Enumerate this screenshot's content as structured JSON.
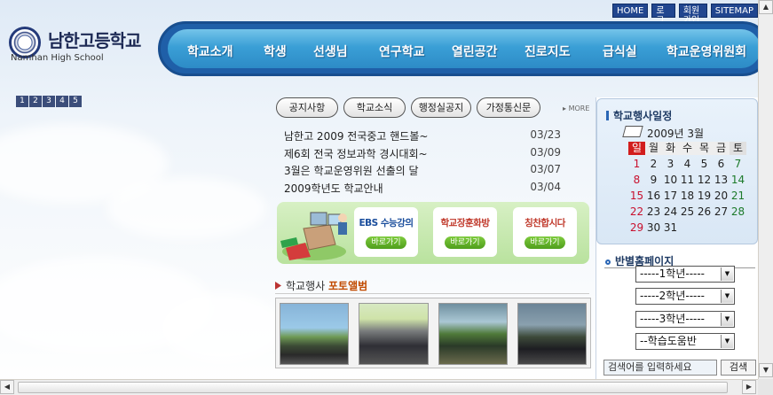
{
  "top_links": [
    "HOME",
    "로그인",
    "회원가입",
    "SITEMAP"
  ],
  "logo": {
    "name_ko": "남한고등학교",
    "name_en": "Namhan High School"
  },
  "nav": {
    "items": [
      "학교소개",
      "학생",
      "선생님",
      "연구학교",
      "열린공간",
      "진로지도",
      "급식실",
      "학교운영위원회"
    ]
  },
  "pagers": [
    "1",
    "2",
    "3",
    "4",
    "5"
  ],
  "tabs": [
    "공지사항",
    "학교소식",
    "행정실공지",
    "가정통신문"
  ],
  "more": "MORE",
  "notices": [
    {
      "title": "남한고 2009 전국중고 핸드볼~",
      "date": "03/23"
    },
    {
      "title": "제6회 전국 정보과학 경시대회~",
      "date": "03/09"
    },
    {
      "title": "3월은 학교운영위원 선출의 달",
      "date": "03/07"
    },
    {
      "title": "2009학년도 학교안내",
      "date": "03/04"
    }
  ],
  "banner": {
    "cards": [
      {
        "title": "EBS 수능강의",
        "button": "바로가기",
        "color": "#1a4d9c"
      },
      {
        "title": "학교장훈화방",
        "button": "바로가기",
        "color": "#c0392b"
      },
      {
        "title": "칭찬합시다",
        "button": "바로가기",
        "color": "#c0392b"
      }
    ]
  },
  "album": {
    "title_prefix": "학교행사",
    "title_highlight": "포토앨범"
  },
  "calendar": {
    "title": "학교행사일정",
    "month": "2009년 3월",
    "weekdays": [
      "일",
      "월",
      "화",
      "수",
      "목",
      "금",
      "토"
    ],
    "weeks": [
      [
        "1",
        "2",
        "3",
        "4",
        "5",
        "6",
        "7"
      ],
      [
        "8",
        "9",
        "10",
        "11",
        "12",
        "13",
        "14"
      ],
      [
        "15",
        "16",
        "17",
        "18",
        "19",
        "20",
        "21"
      ],
      [
        "22",
        "23",
        "24",
        "25",
        "26",
        "27",
        "28"
      ],
      [
        "29",
        "30",
        "31",
        "",
        "",
        "",
        ""
      ]
    ]
  },
  "class_pages": {
    "title": "반별홈페이지",
    "options": [
      "-----1학년-----",
      "-----2학년-----",
      "-----3학년-----",
      "--학습도움반"
    ]
  },
  "search": {
    "placeholder": "검색어를 입력하세요",
    "button": "검색"
  }
}
